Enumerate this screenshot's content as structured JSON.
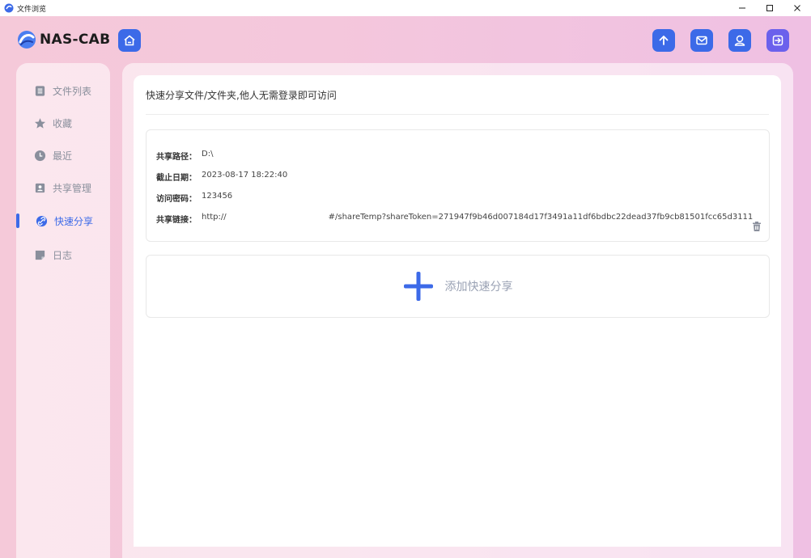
{
  "window": {
    "title": "文件浏览"
  },
  "header": {
    "logo_text": "NAS-CAB"
  },
  "sidebar": {
    "items": [
      {
        "label": "文件列表",
        "icon": "file-list-icon",
        "active": false
      },
      {
        "label": "收藏",
        "icon": "star-icon",
        "active": false
      },
      {
        "label": "最近",
        "icon": "clock-icon",
        "active": false
      },
      {
        "label": "共享管理",
        "icon": "user-share-icon",
        "active": false
      },
      {
        "label": "快速分享",
        "icon": "link-icon",
        "active": true
      },
      {
        "label": "日志",
        "icon": "note-icon",
        "active": false
      }
    ]
  },
  "main": {
    "description": "快速分享文件/文件夹,他人无需登录即可访问",
    "share": {
      "path_label": "共享路径：",
      "path_value": "D:\\",
      "expire_label": "截止日期：",
      "expire_value": "2023-08-17 18:22:40",
      "password_label": "访问密码：",
      "password_value": "123456",
      "link_label": "共享链接：",
      "link_value_prefix": "http://",
      "link_value_suffix": "#/shareTemp?shareToken=271947f9b46d007184d17f3491a11df6bdbc22dead37fb9cb81501fcc65d3111"
    },
    "add_label": "添加快速分享"
  },
  "colors": {
    "accent": "#3c6ae8",
    "logout": "#6b61ec"
  }
}
